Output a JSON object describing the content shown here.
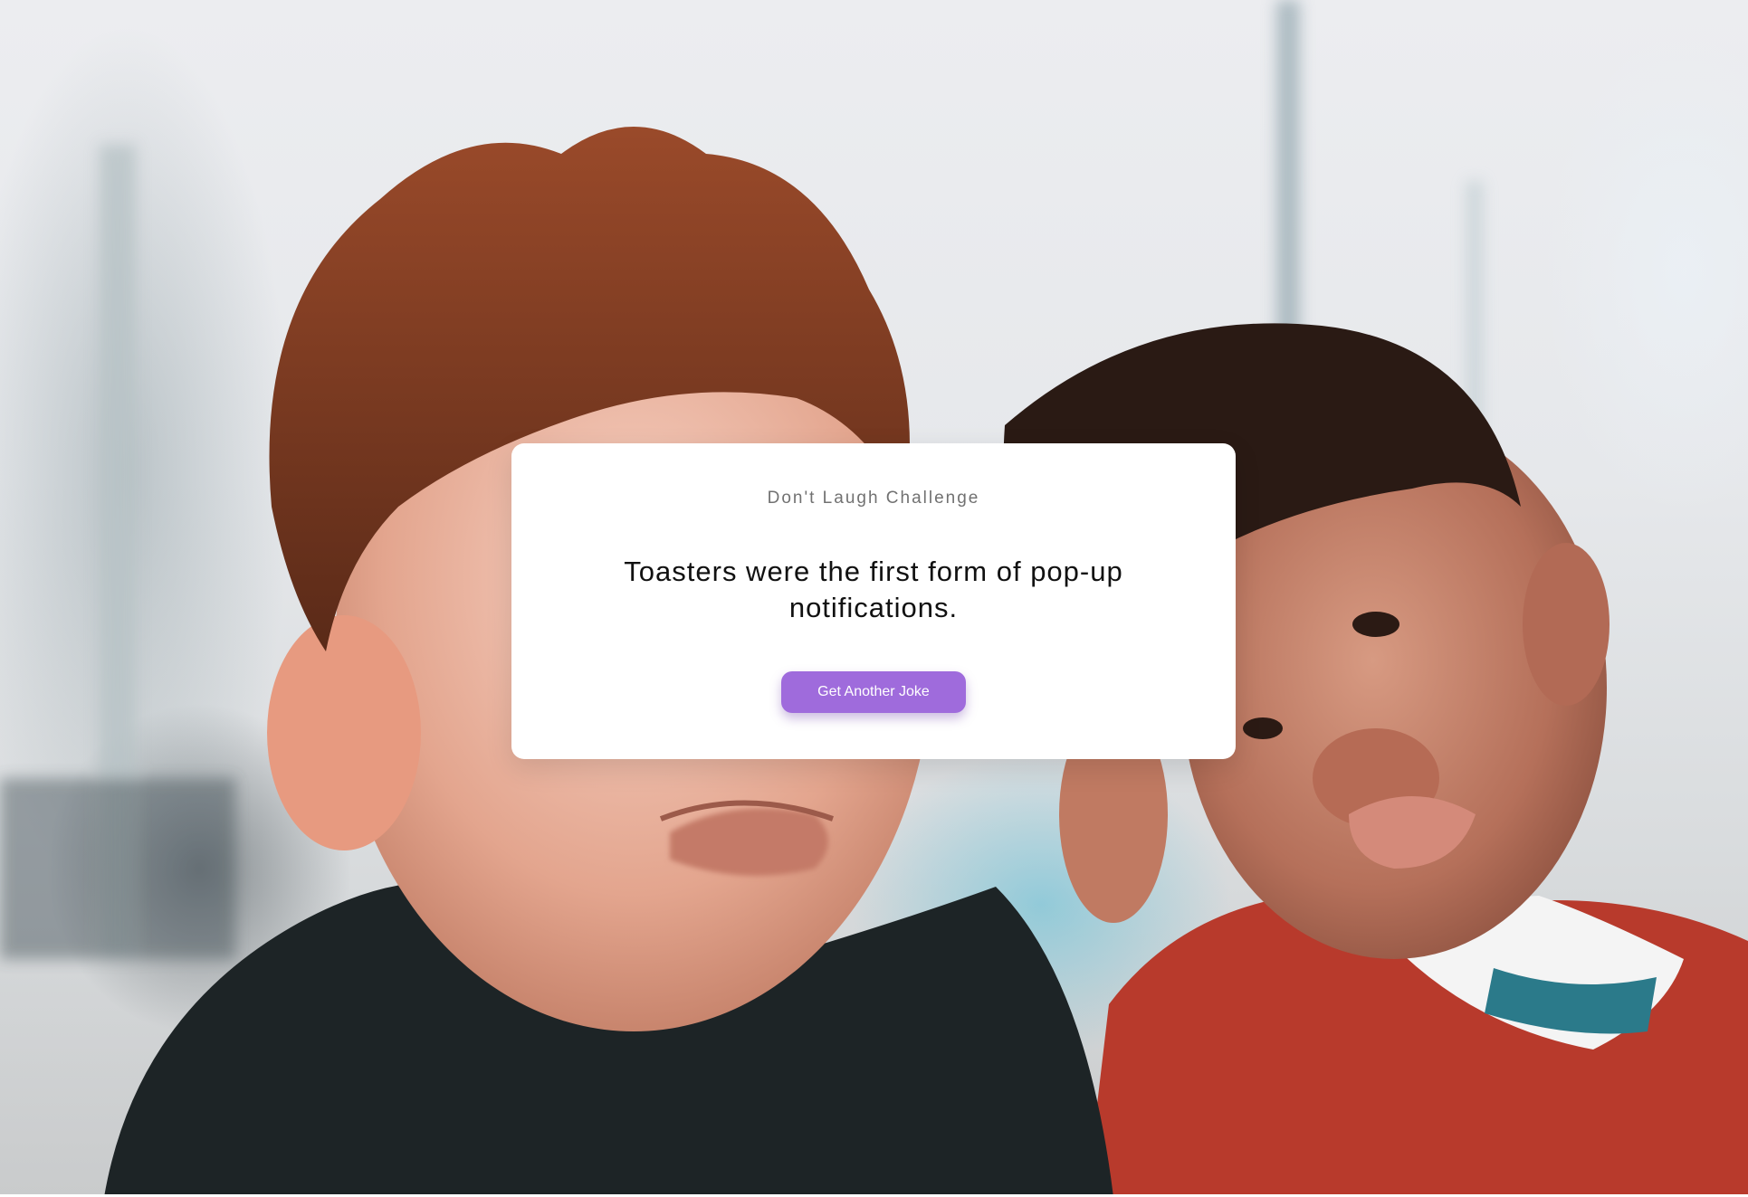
{
  "card": {
    "heading": "Don't Laugh Challenge",
    "joke": "Toasters were the first form of pop-up notifications.",
    "button_label": "Get Another Joke"
  },
  "background": {
    "icon": "photo-two-boys-making-faces"
  },
  "colors": {
    "button": "#9f6bdc",
    "card": "#ffffff",
    "heading": "#717171",
    "joke": "#111111"
  }
}
